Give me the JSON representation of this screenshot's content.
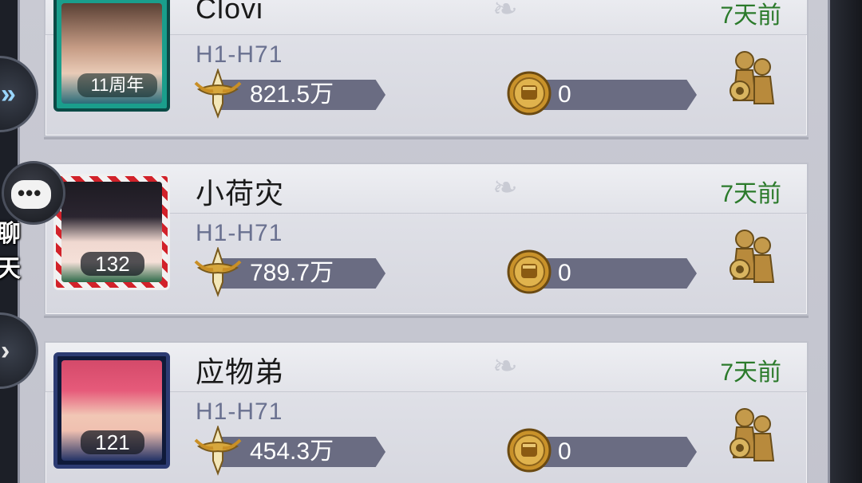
{
  "side": {
    "chat_label": "聊 天"
  },
  "members": [
    {
      "name": "Clovi",
      "time": "7天前",
      "server": "H1-H71",
      "power": "821.5万",
      "fist": "0",
      "level": "",
      "badge": "11周年"
    },
    {
      "name": "小荷灾",
      "time": "7天前",
      "server": "H1-H71",
      "power": "789.7万",
      "fist": "0",
      "level": "132"
    },
    {
      "name": "应物弟",
      "time": "7天前",
      "server": "H1-H71",
      "power": "454.3万",
      "fist": "0",
      "level": "121"
    }
  ],
  "colors": {
    "time_green": "#2b7a2b",
    "server_blue": "#6a7190",
    "bar": "#6a6c82"
  },
  "icons": [
    "sword-icon",
    "fist-coin-icon",
    "people-gear-icon",
    "chevron-right-icon",
    "chat-bubble-icon"
  ]
}
